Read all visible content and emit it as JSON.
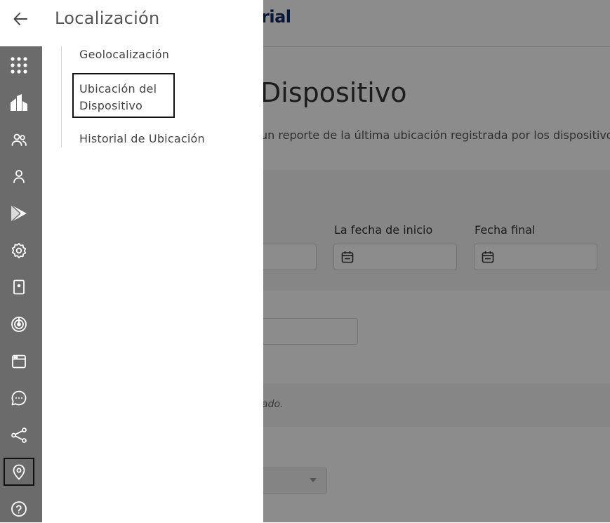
{
  "background": {
    "logo_text": "rial",
    "page_title": "Dispositivo",
    "subtitle": "un reporte de la última ubicación registrada por los dispositivos",
    "start_date_label": "La fecha de inicio",
    "end_date_label": "Fecha final",
    "note": "ado."
  },
  "panel": {
    "title": "Localización",
    "items": [
      {
        "label": "Geolocalización"
      },
      {
        "label": "Ubicación del Dispositivo"
      },
      {
        "label": "Historial de Ubicación"
      }
    ]
  },
  "rail": {
    "items": [
      {
        "icon": "apps-grid-icon"
      },
      {
        "icon": "buildings-icon"
      },
      {
        "icon": "users-icon"
      },
      {
        "icon": "user-icon"
      },
      {
        "icon": "play-store-icon"
      },
      {
        "icon": "settings-gear-icon"
      },
      {
        "icon": "device-icon"
      },
      {
        "icon": "radar-icon"
      },
      {
        "icon": "browser-window-icon"
      },
      {
        "icon": "chat-icon"
      },
      {
        "icon": "share-icon"
      },
      {
        "icon": "location-pin-icon"
      },
      {
        "icon": "help-icon"
      }
    ]
  },
  "colors": {
    "rail_bg": "#6b6b6b",
    "overlay": "rgba(0,0,0,0.45)",
    "logo": "#0b2a6b"
  }
}
